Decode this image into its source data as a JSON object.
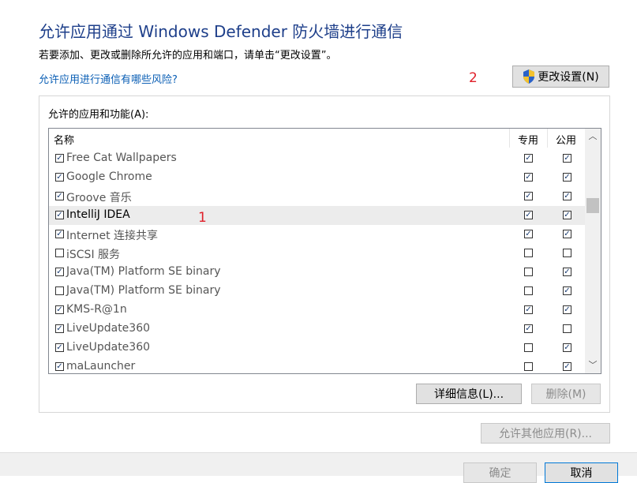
{
  "header": {
    "title": "允许应用通过 Windows Defender 防火墙进行通信",
    "subtitle": "若要添加、更改或删除所允许的应用和端口，请单击“更改设置”。",
    "risk_link": "允许应用进行通信有哪些风险?",
    "change_settings_label": "更改设置(N)"
  },
  "annotations": {
    "one": "1",
    "two": "2"
  },
  "apps": {
    "group_label": "允许的应用和功能(A):",
    "columns": {
      "name": "名称",
      "private": "专用",
      "public": "公用"
    },
    "rows": [
      {
        "name": "Free Cat Wallpapers",
        "enabled": true,
        "private": true,
        "public": true
      },
      {
        "name": "Google Chrome",
        "enabled": true,
        "private": true,
        "public": true
      },
      {
        "name": "Groove 音乐",
        "enabled": true,
        "private": true,
        "public": true
      },
      {
        "name": "IntelliJ IDEA",
        "enabled": true,
        "private": true,
        "public": true
      },
      {
        "name": "Internet 连接共享",
        "enabled": true,
        "private": true,
        "public": true
      },
      {
        "name": "iSCSI 服务",
        "enabled": false,
        "private": false,
        "public": false
      },
      {
        "name": "Java(TM) Platform SE binary",
        "enabled": true,
        "private": false,
        "public": true
      },
      {
        "name": "Java(TM) Platform SE binary",
        "enabled": false,
        "private": false,
        "public": true
      },
      {
        "name": "KMS-R@1n",
        "enabled": true,
        "private": true,
        "public": true
      },
      {
        "name": "LiveUpdate360",
        "enabled": true,
        "private": true,
        "public": false
      },
      {
        "name": "LiveUpdate360",
        "enabled": true,
        "private": false,
        "public": true
      },
      {
        "name": "maLauncher",
        "enabled": true,
        "private": false,
        "public": true
      }
    ],
    "selected_row": "IntelliJ IDEA",
    "scroll_position": 0.27,
    "scroll_visible_fraction": 0.07,
    "details_label": "详细信息(L)...",
    "remove_label": "删除(M)"
  },
  "allow_other_label": "允许其他应用(R)...",
  "footer": {
    "ok_label": "确定",
    "cancel_label": "取消"
  },
  "colors": {
    "title": "#1e3f8a",
    "link": "#0b5fb5",
    "annotation": "#e0202a",
    "selected_row": "#ececec"
  },
  "icons": {
    "change_settings": "uac-shield-icon",
    "checkbox": "checkmark"
  }
}
